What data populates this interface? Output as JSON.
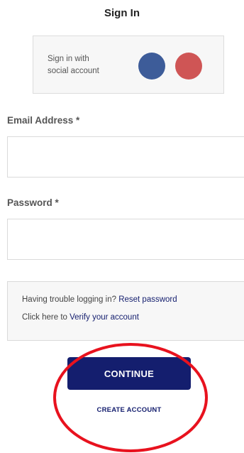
{
  "header": {
    "title": "Sign In"
  },
  "social": {
    "line1": "Sign in with",
    "line2": "social account",
    "buttons": [
      {
        "color": "#3d5c99"
      },
      {
        "color": "#cf5555"
      }
    ]
  },
  "form": {
    "email_label": "Email Address *",
    "email_value": "",
    "password_label": "Password *",
    "password_value": ""
  },
  "help": {
    "line1_text": "Having trouble logging in? ",
    "line1_link": "Reset password",
    "line2_text": "Click here to ",
    "line2_link": "Verify your account"
  },
  "actions": {
    "continue_label": "CONTINUE",
    "create_label": "CREATE ACCOUNT"
  },
  "colors": {
    "primary": "#141e6e",
    "annotation": "#e8121e"
  }
}
